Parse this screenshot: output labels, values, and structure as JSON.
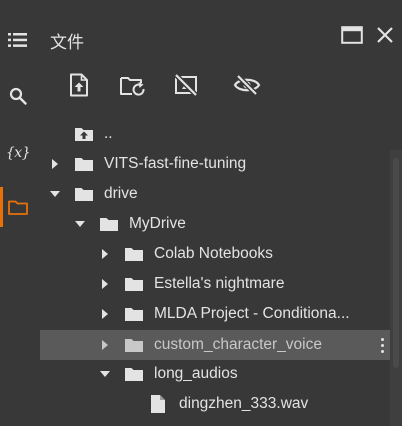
{
  "panel": {
    "title": "文件"
  },
  "colors": {
    "background": "#383838",
    "accent": "#e8710a",
    "selected_row": "#5a5a5a",
    "text": "#e3e3e3"
  },
  "rail": {
    "items": [
      {
        "icon": "table-of-contents-icon"
      },
      {
        "icon": "search-icon"
      },
      {
        "icon": "variables-icon",
        "glyph": "{x}"
      },
      {
        "icon": "folder-icon",
        "active": true
      }
    ]
  },
  "header_actions": [
    {
      "icon": "open-in-tab-icon"
    },
    {
      "icon": "close-icon"
    }
  ],
  "toolbar": [
    {
      "icon": "upload-file-icon"
    },
    {
      "icon": "refresh-folder-icon"
    },
    {
      "icon": "unmount-drive-icon"
    },
    {
      "icon": "hide-hidden-files-icon"
    }
  ],
  "tree": [
    {
      "name": "..",
      "type": "parent-folder",
      "depth": 0,
      "caret": "none"
    },
    {
      "name": "VITS-fast-fine-tuning",
      "type": "folder",
      "depth": 0,
      "caret": "collapsed"
    },
    {
      "name": "drive",
      "type": "folder",
      "depth": 0,
      "caret": "expanded"
    },
    {
      "name": "MyDrive",
      "type": "folder",
      "depth": 1,
      "caret": "expanded"
    },
    {
      "name": "Colab Notebooks",
      "type": "folder",
      "depth": 2,
      "caret": "collapsed"
    },
    {
      "name": "Estella's nightmare",
      "type": "folder",
      "depth": 2,
      "caret": "collapsed"
    },
    {
      "name": "MLDA Project - Conditiona...",
      "type": "folder",
      "depth": 2,
      "caret": "collapsed"
    },
    {
      "name": "custom_character_voice",
      "type": "folder",
      "depth": 2,
      "caret": "collapsed",
      "selected": true
    },
    {
      "name": "long_audios",
      "type": "folder",
      "depth": 2,
      "caret": "expanded"
    },
    {
      "name": "dingzhen_333.wav",
      "type": "file",
      "depth": 3,
      "caret": "none"
    }
  ]
}
